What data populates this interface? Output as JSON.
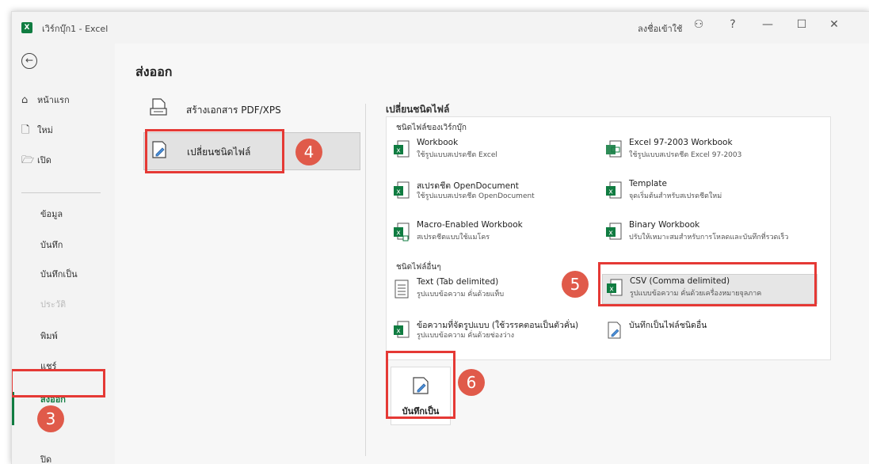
{
  "window": {
    "title": "เวิร์กบุ๊ก1 - Excel",
    "app_icon_letter": "X",
    "signin_label": "ลงชื่อเข้าใช้"
  },
  "titlebar_icons": [
    "people-icon",
    "help-icon",
    "minimize-icon",
    "maximize-icon",
    "close-icon"
  ],
  "titlebar_glyphs": {
    "people": "⚇",
    "help": "?",
    "minimize": "—",
    "maximize": "☐",
    "close": "✕"
  },
  "nav": {
    "back_glyph": "←",
    "top_items": [
      {
        "label": "หน้าแรก",
        "icon": "home-icon",
        "glyph": "⌂"
      },
      {
        "label": "ใหม่",
        "icon": "new-file-icon",
        "glyph": "🗋"
      },
      {
        "label": "เปิด",
        "icon": "folder-icon",
        "glyph": "🗁"
      }
    ],
    "sub_items": [
      {
        "label": "ข้อมูล"
      },
      {
        "label": "บันทึก"
      },
      {
        "label": "บันทึกเป็น"
      },
      {
        "label": "ประวัติ"
      },
      {
        "label": "พิมพ์"
      },
      {
        "label": "แชร์"
      },
      {
        "label": "ส่งออก"
      },
      {
        "label": "ปิด"
      }
    ]
  },
  "main": {
    "title": "ส่งออก",
    "options": [
      {
        "label": "สร้างเอกสาร PDF/XPS",
        "icon": "pdf-document-icon"
      },
      {
        "label": "เปลี่ยนชนิดไฟล์",
        "icon": "change-file-type-icon"
      }
    ],
    "right_title": "เปลี่ยนชนิดไฟล์",
    "workbook_group_label": "ชนิดไฟล์ของเวิร์กบุ๊ก",
    "other_group_label": "ชนิดไฟล์อื่นๆ",
    "file_types": {
      "workbook": {
        "name": "Workbook",
        "desc": "ใช้รูปแบบสเปรดชีต Excel"
      },
      "excel97": {
        "name": "Excel 97-2003 Workbook",
        "desc": "ใช้รูปแบบสเปรดชีต Excel 97-2003"
      },
      "opendoc": {
        "name": "สเปรดชีต OpenDocument",
        "desc": "ใช้รูปแบบสเปรดชีต OpenDocument"
      },
      "template": {
        "name": "Template",
        "desc": "จุดเริ่มต้นสำหรับสเปรดชีตใหม่"
      },
      "macro": {
        "name": "Macro-Enabled Workbook",
        "desc": "สเปรดชีตแบบใช้แมโคร"
      },
      "binary": {
        "name": "Binary Workbook",
        "desc": "ปรับให้เหมาะสมสำหรับการโหลดและบันทึกที่รวดเร็ว"
      },
      "text": {
        "name": "Text (Tab delimited)",
        "desc": "รูปแบบข้อความ คั่นด้วยแท็บ"
      },
      "csv": {
        "name": "CSV (Comma delimited)",
        "desc": "รูปแบบข้อความ คั่นด้วยเครื่องหมายจุลภาค"
      },
      "formatted": {
        "name": "ข้อความที่จัดรูปแบบ (ใช้วรรคตอนเป็นตัวคั่น)",
        "desc": "รูปแบบข้อความ คั่นด้วยช่องว่าง"
      },
      "other": {
        "name": "บันทึกเป็นไฟล์ชนิดอื่น",
        "desc": ""
      }
    },
    "save_as_label": "บันทึกเป็น"
  },
  "annotations": {
    "step3": "3",
    "step4": "4",
    "step5": "5",
    "step6": "6"
  },
  "colors": {
    "accent": "#107c41",
    "annotation_red": "#e53935",
    "badge_red": "#e05a4a"
  }
}
